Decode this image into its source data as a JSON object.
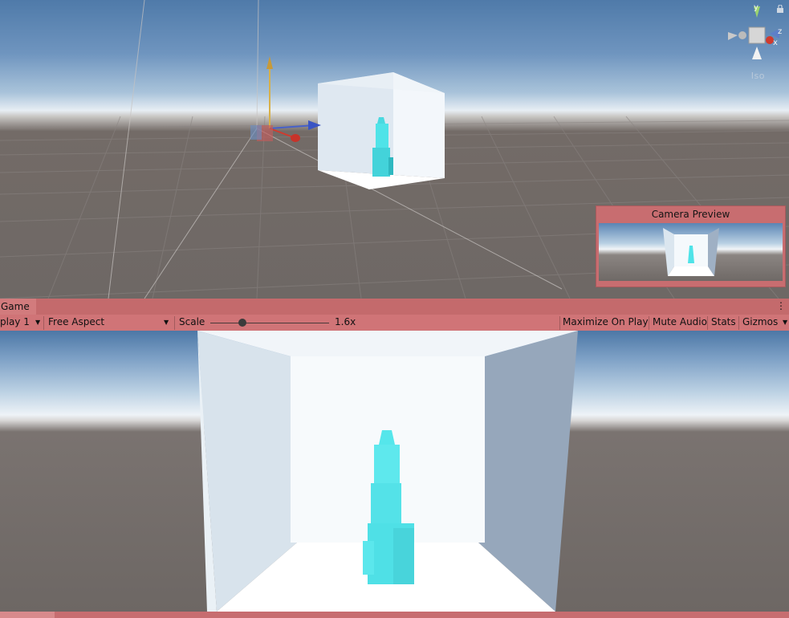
{
  "scene": {
    "gizmo": {
      "axis_y": "y",
      "axis_z": "z",
      "axis_x": "x"
    },
    "persp_label": "Iso",
    "icons": [
      "lock-icon",
      "move-tool-icon",
      "camera-gizmo-icon"
    ]
  },
  "camera_preview": {
    "title": "Camera Preview"
  },
  "game_tab": {
    "label": "Game",
    "menu_icon": "kebab-menu-icon"
  },
  "toolbar": {
    "display": "play 1",
    "aspect": "Free Aspect",
    "scale_label": "Scale",
    "scale_value": "1.6x",
    "scale_fraction": 0.27,
    "maximize": "Maximize On Play",
    "mute": "Mute Audio",
    "stats": "Stats",
    "gizmos": "Gizmos"
  },
  "colors": {
    "panel_tint": "#c86d70",
    "cyan_object": "#4fe3e8",
    "room_wall": "#e8f1f8"
  }
}
